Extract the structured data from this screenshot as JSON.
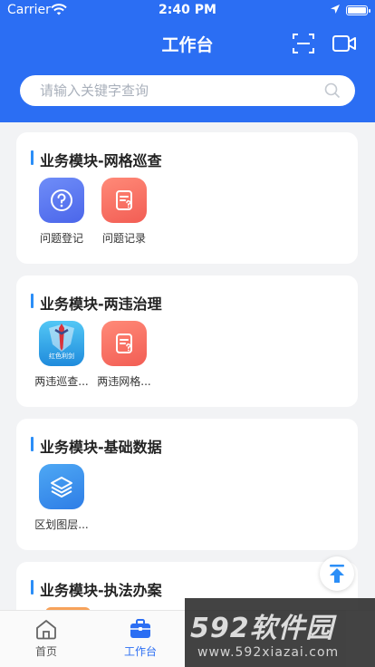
{
  "status_bar": {
    "carrier": "Carrier",
    "time": "2:40 PM"
  },
  "header": {
    "title": "工作台"
  },
  "search": {
    "placeholder": "请输入关键字查询"
  },
  "sections": [
    {
      "title": "业务模块-网格巡查",
      "items": [
        {
          "label": "问题登记",
          "icon": "question-icon"
        },
        {
          "label": "问题记录",
          "icon": "document-icon"
        }
      ]
    },
    {
      "title": "业务模块-两违治理",
      "items": [
        {
          "label": "两违巡查...",
          "icon": "sword-shield-icon",
          "icon_text": "红色利剑"
        },
        {
          "label": "两违网格...",
          "icon": "document-icon"
        }
      ]
    },
    {
      "title": "业务模块-基础数据",
      "items": [
        {
          "label": "区划图层...",
          "icon": "layers-icon"
        }
      ]
    },
    {
      "title": "业务模块-执法办案",
      "items": []
    }
  ],
  "tabbar": {
    "items": [
      {
        "label": "首页",
        "icon": "home-icon"
      },
      {
        "label": "工作台",
        "icon": "briefcase-icon",
        "active": true
      }
    ]
  },
  "watermark": {
    "logo": "592软件园",
    "url": "www.592xiazai.com"
  },
  "colors": {
    "primary": "#2b6ef3",
    "accent_bar": "#2b8ef7",
    "red_icon": "#f25d54",
    "blue_icon": "#4b66ea"
  }
}
